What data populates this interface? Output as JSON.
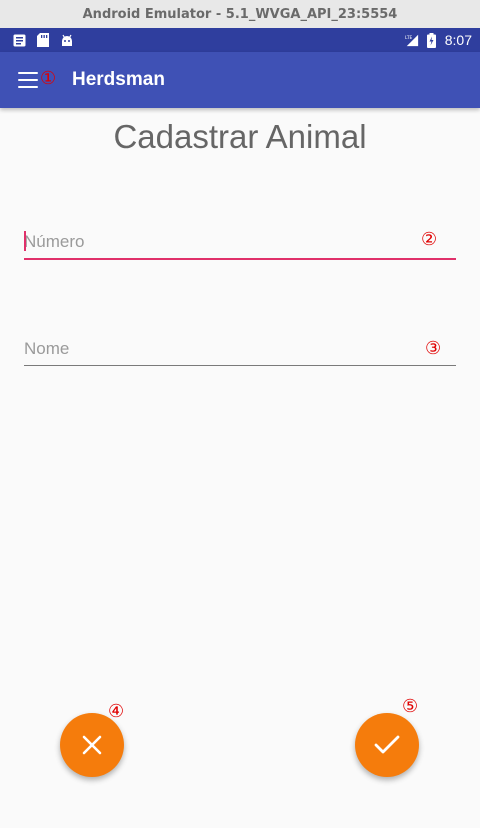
{
  "window": {
    "title": "Android Emulator - 5.1_WVGA_API_23:5554"
  },
  "status_bar": {
    "time": "8:07",
    "left_icons": [
      "notification-icon",
      "sd-card-icon",
      "android-icon"
    ],
    "right_icons": [
      "lte-signal-icon",
      "battery-icon"
    ]
  },
  "app_bar": {
    "title": "Herdsman",
    "menu_icon": "hamburger-menu-icon"
  },
  "page": {
    "title": "Cadastrar Animal"
  },
  "form": {
    "numero": {
      "placeholder": "Número",
      "value": ""
    },
    "nome": {
      "placeholder": "Nome",
      "value": ""
    }
  },
  "fabs": {
    "cancel_icon": "close-icon",
    "confirm_icon": "check-icon"
  },
  "markers": [
    "①",
    "②",
    "③",
    "④",
    "⑤"
  ],
  "colors": {
    "primary": "#3f51b5",
    "primary_dark": "#2f3e9e",
    "accent": "#f57c0c",
    "focus": "#e0306a"
  }
}
